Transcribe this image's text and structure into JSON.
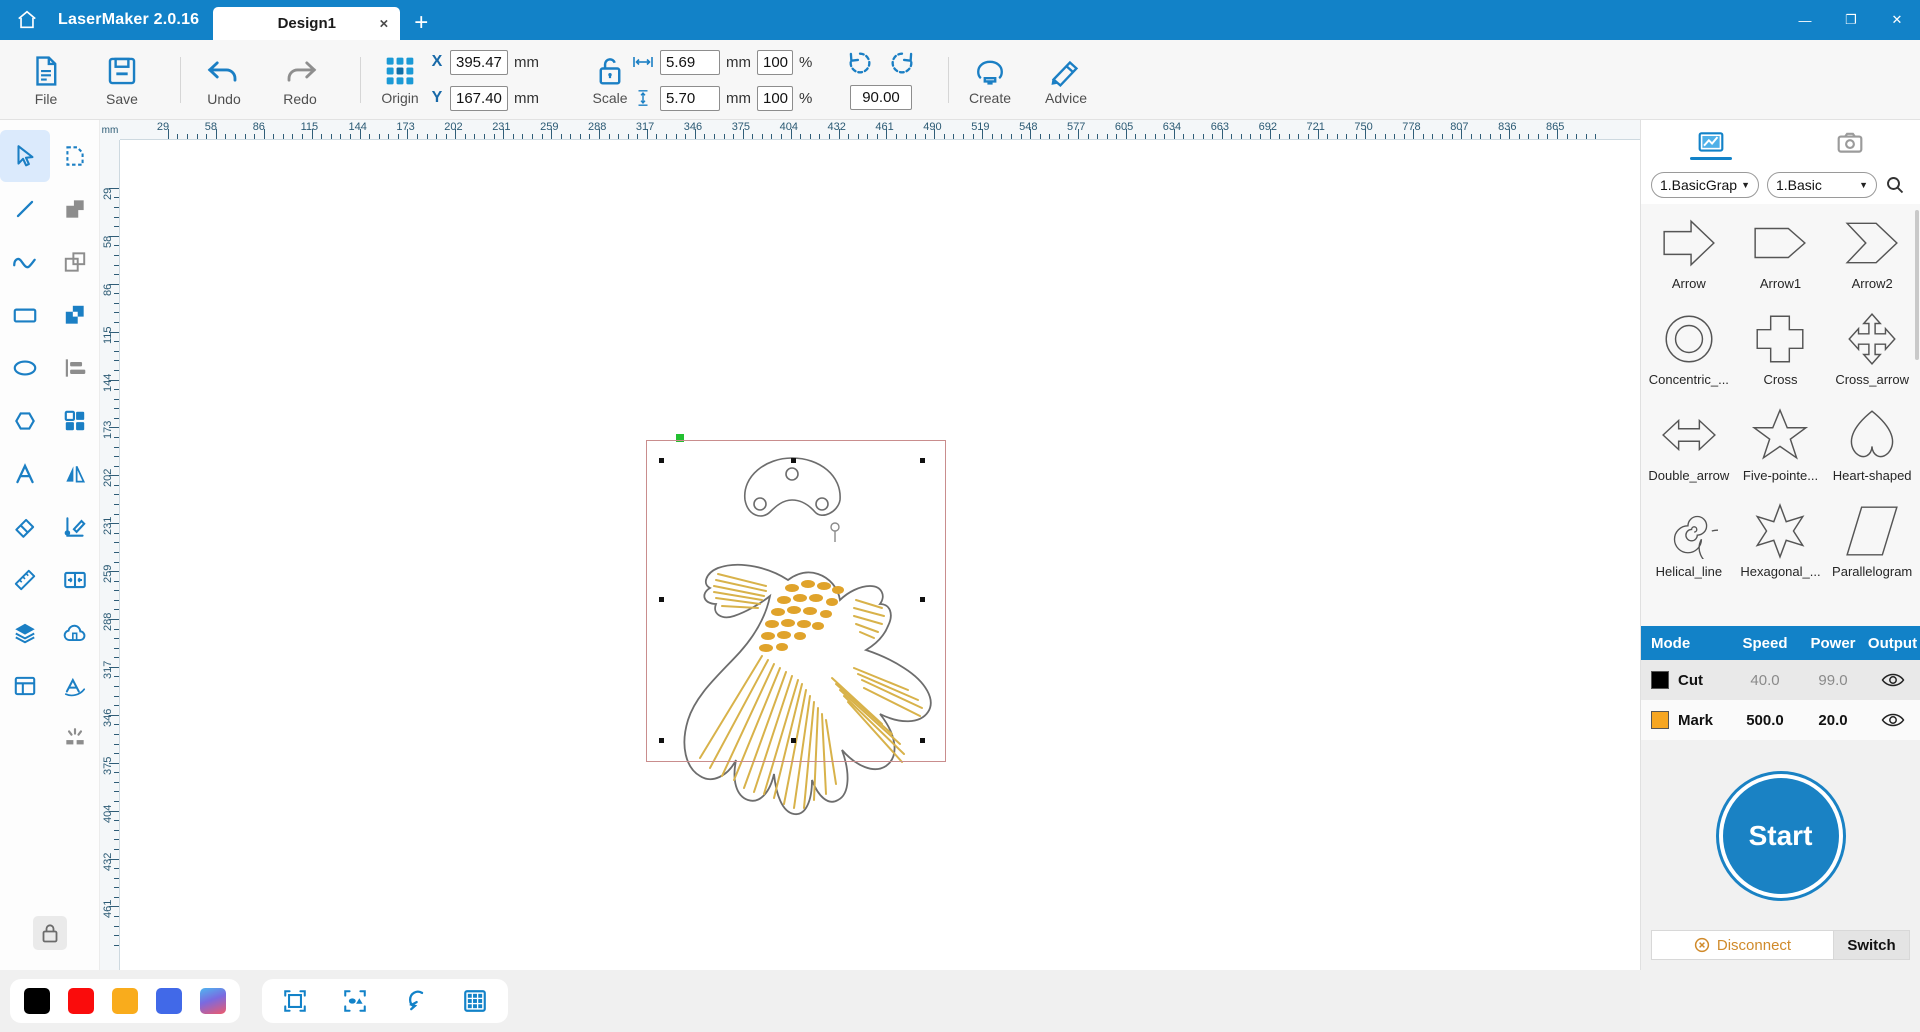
{
  "titlebar": {
    "home_icon": "home-icon",
    "app_name": "LaserMaker 2.0.16",
    "tabs": [
      {
        "label": "Design1",
        "close": "×"
      }
    ],
    "new_tab": "+",
    "window_buttons": {
      "minimize": "—",
      "maximize": "❐",
      "close": "✕"
    }
  },
  "ribbon": {
    "file_label": "File",
    "save_label": "Save",
    "undo_label": "Undo",
    "redo_label": "Redo",
    "origin_label": "Origin",
    "scale_label": "Scale",
    "create_label": "Create",
    "advice_label": "Advice",
    "position": {
      "x_label": "X",
      "x_value": "395.47",
      "x_unit": "mm",
      "y_label": "Y",
      "y_value": "167.40",
      "y_unit": "mm"
    },
    "size": {
      "width_value": "5.69",
      "width_unit": "mm",
      "width_percent": "100",
      "height_value": "5.70",
      "height_unit": "mm",
      "height_percent": "100",
      "percent_symbol": "%"
    },
    "rotation": {
      "value": "90.00"
    }
  },
  "left_tools": [
    {
      "name": "select-tool",
      "icon": "cursor-arrow-icon",
      "selected": true
    },
    {
      "name": "node-edit-tool",
      "icon": "node-edit-icon",
      "selected": false
    },
    {
      "name": "line-tool",
      "icon": "line-icon",
      "selected": false
    },
    {
      "name": "union-tool",
      "icon": "union-shapes-icon",
      "selected": false
    },
    {
      "name": "curve-tool",
      "icon": "bezier-curve-icon",
      "selected": false
    },
    {
      "name": "subtract-tool",
      "icon": "subtract-shapes-icon",
      "selected": false
    },
    {
      "name": "rectangle-tool",
      "icon": "rectangle-icon",
      "selected": false
    },
    {
      "name": "intersect-tool",
      "icon": "intersect-shapes-icon",
      "selected": false
    },
    {
      "name": "ellipse-tool",
      "icon": "ellipse-icon",
      "selected": false
    },
    {
      "name": "align-tool",
      "icon": "align-left-icon",
      "selected": false
    },
    {
      "name": "polygon-tool",
      "icon": "hexagon-icon",
      "selected": false
    },
    {
      "name": "array-tool",
      "icon": "grid-four-icon",
      "selected": false
    },
    {
      "name": "text-tool",
      "icon": "text-a-icon",
      "selected": false
    },
    {
      "name": "mirror-tool",
      "icon": "mirror-icon",
      "selected": false
    },
    {
      "name": "eraser-tool",
      "icon": "eraser-icon",
      "selected": false
    },
    {
      "name": "measure-angle-tool",
      "icon": "angle-pencil-icon",
      "selected": false
    },
    {
      "name": "ruler-tool",
      "icon": "ruler-icon",
      "selected": false
    },
    {
      "name": "offset-tool",
      "icon": "offset-inward-icon",
      "selected": false
    },
    {
      "name": "layers-tool",
      "icon": "layers-stack-icon",
      "selected": false
    },
    {
      "name": "cloud-tool",
      "icon": "cloud-icon",
      "selected": false
    },
    {
      "name": "layout-tool",
      "icon": "layout-panel-icon",
      "selected": false
    },
    {
      "name": "text-path-tool",
      "icon": "text-on-path-icon",
      "selected": false
    },
    {
      "name": "engrave-tool",
      "icon": "laser-spark-icon",
      "selected": false
    }
  ],
  "left_lock": {
    "icon": "lock-icon"
  },
  "rulers": {
    "unit": "mm",
    "horizontal_ticks": [
      "29",
      "58",
      "86",
      "115",
      "144",
      "173",
      "202",
      "231",
      "259",
      "288",
      "317",
      "346",
      "375",
      "404",
      "432",
      "461",
      "490",
      "519",
      "548",
      "577",
      "605",
      "634",
      "663",
      "692",
      "721",
      "750",
      "778",
      "807",
      "836",
      "865"
    ],
    "vertical_ticks": [
      "29",
      "58",
      "86",
      "115",
      "144",
      "173",
      "202",
      "231",
      "259",
      "288",
      "317",
      "346",
      "375",
      "404",
      "432",
      "461"
    ]
  },
  "canvas": {
    "artwork_name": "goldfish-artwork",
    "selection_visible": true,
    "green_marker": "origin-marker"
  },
  "right_panel": {
    "tabs": [
      {
        "name": "graphics-library-tab",
        "icon": "image-chart-icon",
        "active": true
      },
      {
        "name": "camera-tab",
        "icon": "camera-icon",
        "active": false
      }
    ],
    "category_select": "1.BasicGrap",
    "subcategory_select": "1.Basic",
    "search_icon": "search-icon",
    "caret": "▼",
    "shapes": [
      {
        "name": "Arrow",
        "icon": "arrow-shape"
      },
      {
        "name": "Arrow1",
        "icon": "arrow1-shape"
      },
      {
        "name": "Arrow2",
        "icon": "arrow2-shape"
      },
      {
        "name": "Concentric_...",
        "icon": "concentric-circles-shape"
      },
      {
        "name": "Cross",
        "icon": "cross-shape"
      },
      {
        "name": "Cross_arrow",
        "icon": "cross-arrow-shape"
      },
      {
        "name": "Double_arrow",
        "icon": "double-arrow-shape"
      },
      {
        "name": "Five-pointe...",
        "icon": "five-pointed-star-shape"
      },
      {
        "name": "Heart-shaped",
        "icon": "heart-shape"
      },
      {
        "name": "Helical_line",
        "icon": "helical-line-shape"
      },
      {
        "name": "Hexagonal_...",
        "icon": "hexagonal-star-shape"
      },
      {
        "name": "Parallelogram",
        "icon": "parallelogram-shape"
      }
    ],
    "mode_table": {
      "headers": [
        "Mode",
        "Speed",
        "Power",
        "Output"
      ],
      "rows": [
        {
          "color": "#000000",
          "mode": "Cut",
          "speed": "40.0",
          "power": "99.0",
          "output_icon": "eye-icon"
        },
        {
          "color": "#f5a623",
          "mode": "Mark",
          "speed": "500.0",
          "power": "20.0",
          "output_icon": "eye-icon"
        }
      ]
    },
    "start_button": "Start",
    "disconnect_label": "Disconnect",
    "disconnect_icon": "error-circle-icon",
    "switch_label": "Switch"
  },
  "bottom_bar": {
    "colors": [
      {
        "name": "black-color",
        "value": "#000000"
      },
      {
        "name": "red-color",
        "value": "#fa0c0c"
      },
      {
        "name": "orange-color",
        "value": "#f9ac1c"
      },
      {
        "name": "blue-color",
        "value": "#4169e8"
      },
      {
        "name": "gradient-color",
        "value": "gradient"
      }
    ],
    "tools": [
      {
        "name": "fit-to-frame-button",
        "icon": "frame-fit-icon"
      },
      {
        "name": "select-objects-button",
        "icon": "select-objects-icon"
      },
      {
        "name": "magnet-snap-button",
        "icon": "magnet-icon"
      },
      {
        "name": "grid-toggle-button",
        "icon": "grid-icon"
      }
    ]
  },
  "colors": {
    "accent": "#1282c8",
    "ribbon_bg": "#f7f7f7",
    "panel_bg": "#f1f1f1",
    "selection_border": "#c98d8d",
    "mark_orange": "#f5a623"
  }
}
